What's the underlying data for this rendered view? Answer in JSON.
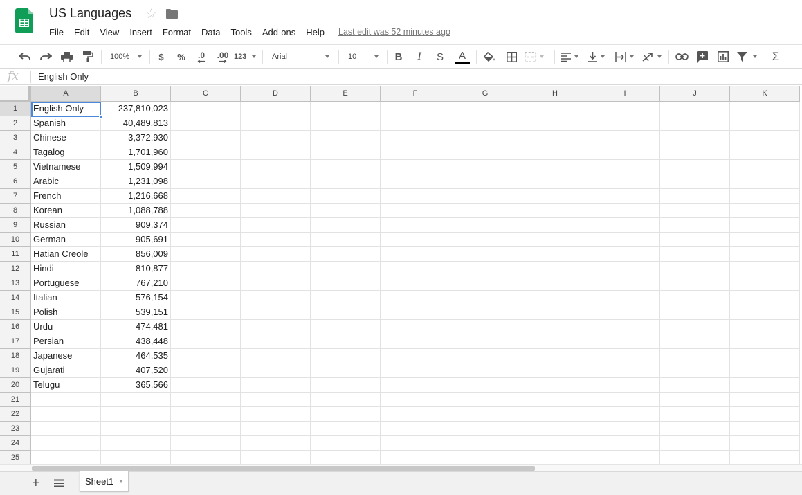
{
  "document": {
    "title": "US Languages",
    "last_edit": "Last edit was 52 minutes ago"
  },
  "menu": [
    "File",
    "Edit",
    "View",
    "Insert",
    "Format",
    "Data",
    "Tools",
    "Add-ons",
    "Help"
  ],
  "toolbar": {
    "zoom": "100%",
    "currency": "$",
    "percent": "%",
    "decrease_decimals": ".0",
    "increase_decimals": ".00",
    "more_formats": "123",
    "font": "Arial",
    "font_size": "10",
    "bold": "B",
    "italic": "I",
    "strikethrough": "S",
    "text_color": "A",
    "text_color_value": "#000000",
    "sum": "Σ"
  },
  "formula_bar": {
    "fx": "fx",
    "value": "English Only"
  },
  "grid": {
    "columns": [
      "A",
      "B",
      "C",
      "D",
      "E",
      "F",
      "G",
      "H",
      "I",
      "J",
      "K"
    ],
    "row_numbers": [
      "1",
      "2",
      "3",
      "4",
      "5",
      "6",
      "7",
      "8",
      "9",
      "10",
      "11",
      "12",
      "13",
      "14",
      "15",
      "16",
      "17",
      "18",
      "19",
      "20",
      "21",
      "22",
      "23",
      "24",
      "25"
    ],
    "active_cell": "A1",
    "rows": [
      [
        "English Only",
        "237,810,023"
      ],
      [
        "Spanish",
        "40,489,813"
      ],
      [
        "Chinese",
        "3,372,930"
      ],
      [
        "Tagalog",
        "1,701,960"
      ],
      [
        "Vietnamese",
        "1,509,994"
      ],
      [
        "Arabic",
        "1,231,098"
      ],
      [
        "French",
        "1,216,668"
      ],
      [
        "Korean",
        "1,088,788"
      ],
      [
        "Russian",
        "909,374"
      ],
      [
        "German",
        "905,691"
      ],
      [
        "Hatian Creole",
        "856,009"
      ],
      [
        "Hindi",
        "810,877"
      ],
      [
        "Portuguese",
        "767,210"
      ],
      [
        "Italian",
        "576,154"
      ],
      [
        "Polish",
        "539,151"
      ],
      [
        "Urdu",
        "474,481"
      ],
      [
        "Persian",
        "438,448"
      ],
      [
        "Japanese",
        "464,535"
      ],
      [
        "Gujarati",
        "407,520"
      ],
      [
        "Telugu",
        "365,566"
      ]
    ]
  },
  "sheets": {
    "add_sheet": "+",
    "tabs": [
      "Sheet1"
    ]
  },
  "colors": {
    "accent": "#4a89dc",
    "sheets_green": "#0f9d58"
  }
}
